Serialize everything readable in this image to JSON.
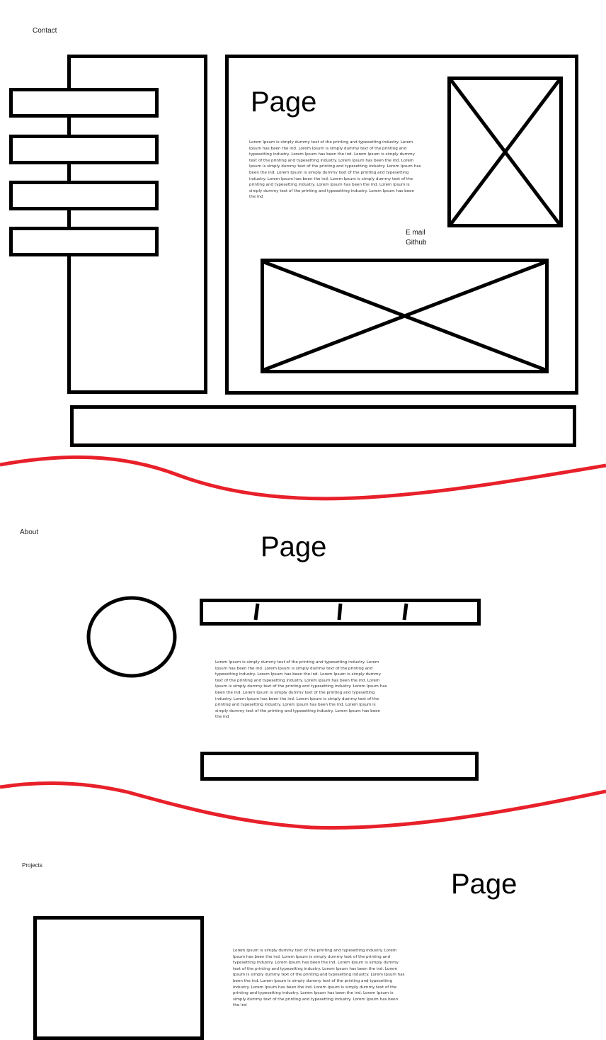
{
  "contact_section": {
    "label": "Contact",
    "heading": "Page",
    "body_text": "Lorem Ipsum is simply dummy text of the printing and typesetting industry. Lorem Ipsum has been the ind. Lorem Ipsum is simply dummy text of the printing and typesetting industry. Lorem Ipsum has been the ind. Lorem Ipsum is simply dummy text of the printing and typesetting industry. Lorem Ipsum has been the ind. Lorem Ipsum is simply dummy text of the printing and typesetting industry. Lorem Ipsum has been the ind. Lorem Ipsum is simply dummy text of the printing and typesetting industry. Lorem Ipsum has been the ind. Lorem Ipsum is simply dummy text of the printing and typesetting industry. Lorem Ipsum has been the ind. Lorem Ipsum is simply dummy text of the printing and typesetting industry. Lorem Ipsum has been the ind",
    "links": [
      "E mail",
      "Github"
    ]
  },
  "about_section": {
    "label": "About",
    "heading": "Page",
    "body_text": "Lorem Ipsum is simply dummy text of the printing and typesetting industry. Lorem Ipsum has been the ind. Lorem Ipsum is simply dummy text of the printing and typesetting industry. Lorem Ipsum has been the ind. Lorem Ipsum is simply dummy text of the printing and typesetting industry. Lorem Ipsum has been the ind. Lorem Ipsum is simply dummy text of the printing and typesetting industry. Lorem Ipsum has been the ind. Lorem Ipsum is simply dummy text of the printing and typesetting industry. Lorem Ipsum has been the ind. Lorem Ipsum is simply dummy text of the printing and typesetting industry. Lorem Ipsum has been the ind. Lorem Ipsum is simply dummy text of the printing and typesetting industry. Lorem Ipsum has been the ind"
  },
  "projects_section": {
    "label": "Projects",
    "heading": "Page",
    "body_text": "Lorem Ipsum is simply dummy text of the printing and typesetting industry. Lorem Ipsum has been the ind. Lorem Ipsum is simply dummy text of the printing and typesetting industry. Lorem Ipsum has been the ind. Lorem Ipsum is simply dummy text of the printing and typesetting industry. Lorem Ipsum has been the ind. Lorem Ipsum is simply dummy text of the printing and typesetting industry. Lorem Ipsum has been the ind. Lorem Ipsum is simply dummy text of the printing and typesetting industry. Lorem Ipsum has been the ind. Lorem Ipsum is simply dummy text of the printing and typesetting industry. Lorem Ipsum has been the ind. Lorem Ipsum is simply dummy text of the printing and typesetting industry. Lorem Ipsum has been the ind"
  },
  "colors": {
    "stroke": "#000000",
    "divider": "#e8202a"
  }
}
